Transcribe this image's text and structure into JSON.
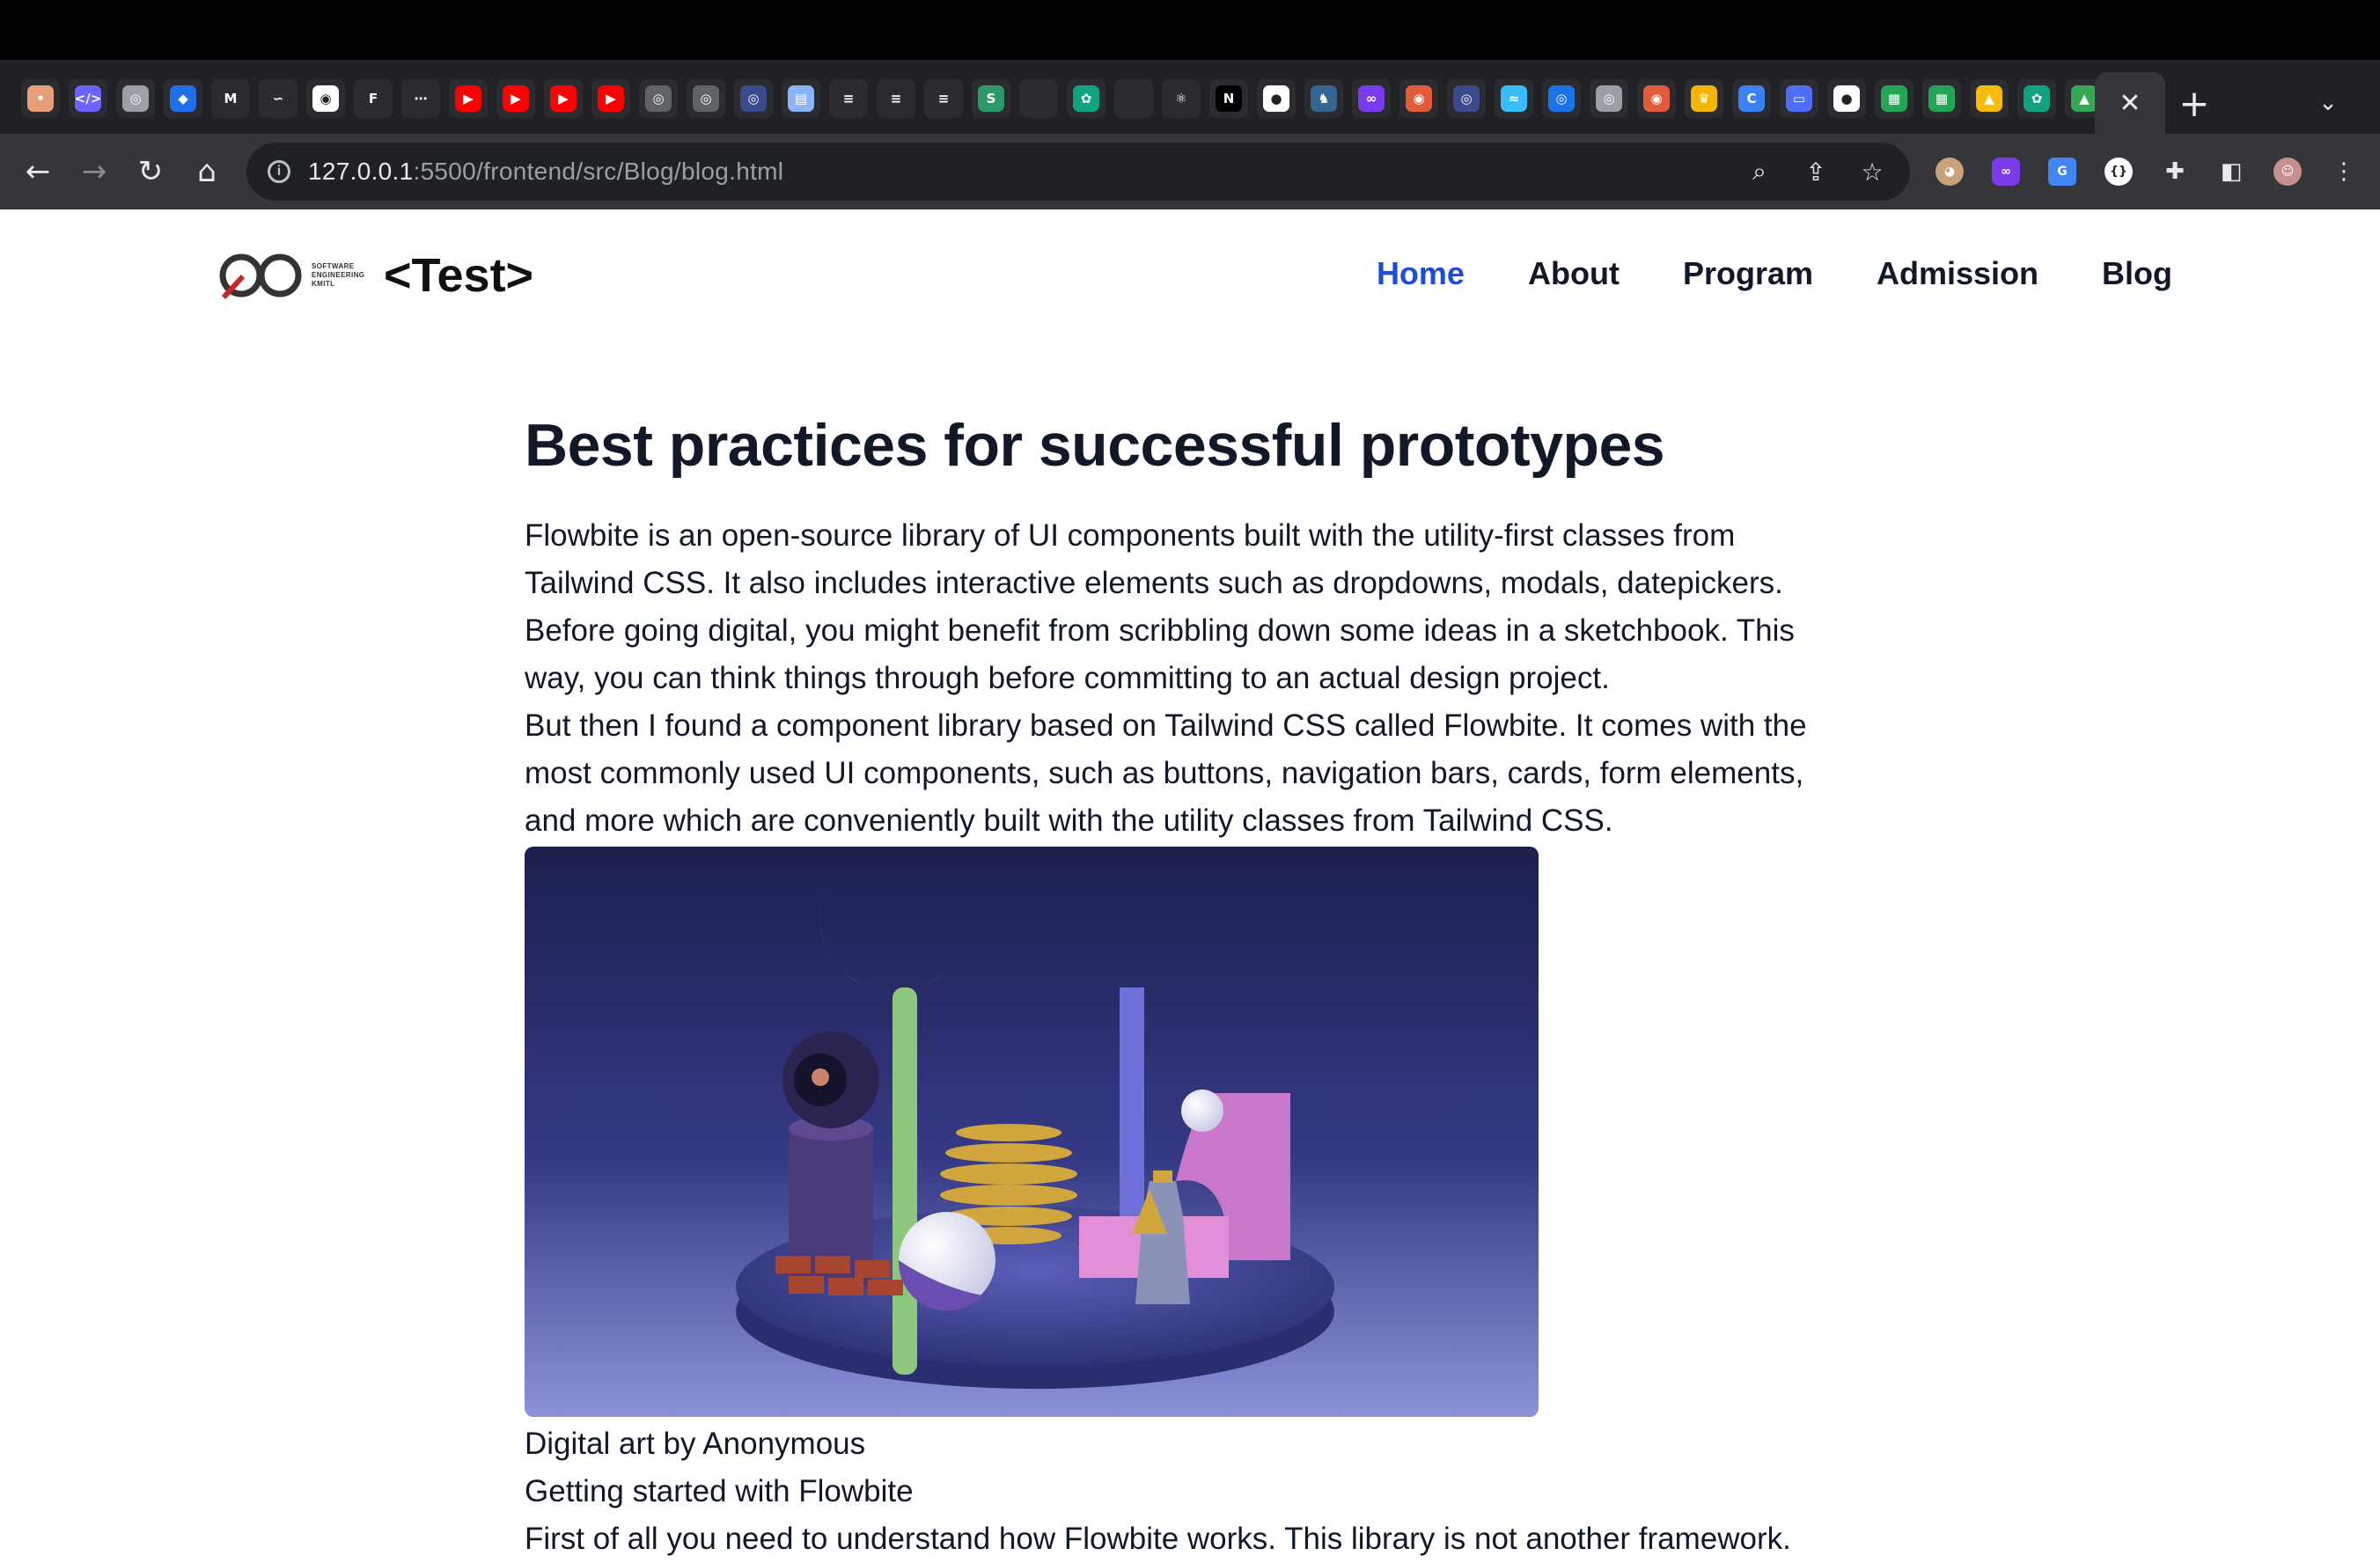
{
  "browser": {
    "tab_favicons": [
      {
        "icon": "generic-site-icon",
        "bg": "#e5a07a",
        "glyph": "•"
      },
      {
        "icon": "code-icon",
        "bg": "#6c63ff",
        "glyph": "</>"
      },
      {
        "icon": "orbit-icon",
        "bg": "#9aa0a6",
        "glyph": "◎"
      },
      {
        "icon": "leaf-icon",
        "bg": "#1f6feb",
        "glyph": "◆"
      },
      {
        "icon": "m-icon",
        "bg": "#2b2c2f",
        "glyph": "M"
      },
      {
        "icon": "wave-icon",
        "bg": "#2b2c2f",
        "glyph": "∽"
      },
      {
        "icon": "aperture-icon",
        "bg": "#ffffff",
        "glyph": "◉"
      },
      {
        "icon": "f-icon",
        "bg": "#2b2c2f",
        "glyph": "F"
      },
      {
        "icon": "dots-icon",
        "bg": "#2b2c2f",
        "glyph": "⋯"
      },
      {
        "icon": "youtube-icon",
        "bg": "#ff0000",
        "glyph": "▶"
      },
      {
        "icon": "youtube-icon",
        "bg": "#ff0000",
        "glyph": "▶"
      },
      {
        "icon": "youtube-icon",
        "bg": "#ff0000",
        "glyph": "▶"
      },
      {
        "icon": "youtube-icon",
        "bg": "#ff0000",
        "glyph": "▶"
      },
      {
        "icon": "circle-icon",
        "bg": "#5f6368",
        "glyph": "◎"
      },
      {
        "icon": "circle-icon",
        "bg": "#5f6368",
        "glyph": "◎"
      },
      {
        "icon": "circle-icon",
        "bg": "#3b4a8a",
        "glyph": "◎"
      },
      {
        "icon": "doc-icon",
        "bg": "#8ab4f8",
        "glyph": "▤"
      },
      {
        "icon": "stack-icon",
        "bg": "#2b2c2f",
        "glyph": "≡"
      },
      {
        "icon": "stack-icon",
        "bg": "#2b2c2f",
        "glyph": "≡"
      },
      {
        "icon": "stack-icon",
        "bg": "#2b2c2f",
        "glyph": "≡"
      },
      {
        "icon": "s-icon",
        "bg": "#2b9a66",
        "glyph": "S"
      },
      {
        "icon": "apple-icon",
        "bg": "#2b2c2f",
        "glyph": ""
      },
      {
        "icon": "openai-icon",
        "bg": "#10a37f",
        "glyph": "✿"
      },
      {
        "icon": "apple-icon",
        "bg": "#2b2c2f",
        "glyph": ""
      },
      {
        "icon": "react-icon",
        "bg": "#2b2c2f",
        "glyph": "⚛"
      },
      {
        "icon": "n-icon",
        "bg": "#000000",
        "glyph": "N"
      },
      {
        "icon": "github-icon",
        "bg": "#ffffff",
        "glyph": "●"
      },
      {
        "icon": "elephant-icon",
        "bg": "#336791",
        "glyph": "♞"
      },
      {
        "icon": "infinity-icon",
        "bg": "#7c3aed",
        "glyph": "∞"
      },
      {
        "icon": "circle-icon",
        "bg": "#e25c3b",
        "glyph": "◉"
      },
      {
        "icon": "circle-icon",
        "bg": "#3b4a8a",
        "glyph": "◎"
      },
      {
        "icon": "tailwind-icon",
        "bg": "#38bdf8",
        "glyph": "≈"
      },
      {
        "icon": "circle-icon",
        "bg": "#1a73e8",
        "glyph": "◎"
      },
      {
        "icon": "circle-icon",
        "bg": "#9aa0a6",
        "glyph": "◎"
      },
      {
        "icon": "circle-icon",
        "bg": "#e25c3b",
        "glyph": "◉"
      },
      {
        "icon": "crown-icon",
        "bg": "#f5b400",
        "glyph": "♛"
      },
      {
        "icon": "c-icon",
        "bg": "#3b82f6",
        "glyph": "C"
      },
      {
        "icon": "screen-icon",
        "bg": "#4f6ef7",
        "glyph": "▭"
      },
      {
        "icon": "github-icon",
        "bg": "#ffffff",
        "glyph": "●"
      },
      {
        "icon": "sheet-icon",
        "bg": "#22a555",
        "glyph": "▦"
      },
      {
        "icon": "sheet-icon",
        "bg": "#22a555",
        "glyph": "▦"
      },
      {
        "icon": "drive-icon",
        "bg": "#fbbc04",
        "glyph": "▲"
      },
      {
        "icon": "openai-icon",
        "bg": "#10a37f",
        "glyph": "✿"
      },
      {
        "icon": "drive-icon",
        "bg": "#34a853",
        "glyph": "▲"
      }
    ],
    "url_host": "127.0.0.1",
    "url_path": ":5500/frontend/src/Blog/blog.html"
  },
  "site": {
    "logo_small_text": [
      "SOFTWARE",
      "ENGINEERING",
      "KMITL"
    ],
    "brand": "<Test>",
    "nav": [
      {
        "label": "Home",
        "active": true
      },
      {
        "label": "About",
        "active": false
      },
      {
        "label": "Program",
        "active": false
      },
      {
        "label": "Admission",
        "active": false
      },
      {
        "label": "Blog",
        "active": false
      }
    ],
    "active_color": "#1d4ed8"
  },
  "article": {
    "title": "Best practices for successful prototypes",
    "paragraph_1": "Flowbite is an open-source library of UI components built with the utility-first classes from Tailwind CSS. It also includes interactive elements such as dropdowns, modals, datepickers.",
    "paragraph_2": "Before going digital, you might benefit from scribbling down some ideas in a sketchbook. This way, you can think things through before committing to an actual design project.",
    "paragraph_3": "But then I found a component library based on Tailwind CSS called Flowbite. It comes with the most commonly used UI components, such as buttons, navigation bars, cards, form elements, and more which are conveniently built with the utility classes from Tailwind CSS.",
    "image_caption": "Digital art by Anonymous",
    "subheading": "Getting started with Flowbite",
    "paragraph_4": "First of all you need to understand how Flowbite works. This library is not another framework."
  }
}
